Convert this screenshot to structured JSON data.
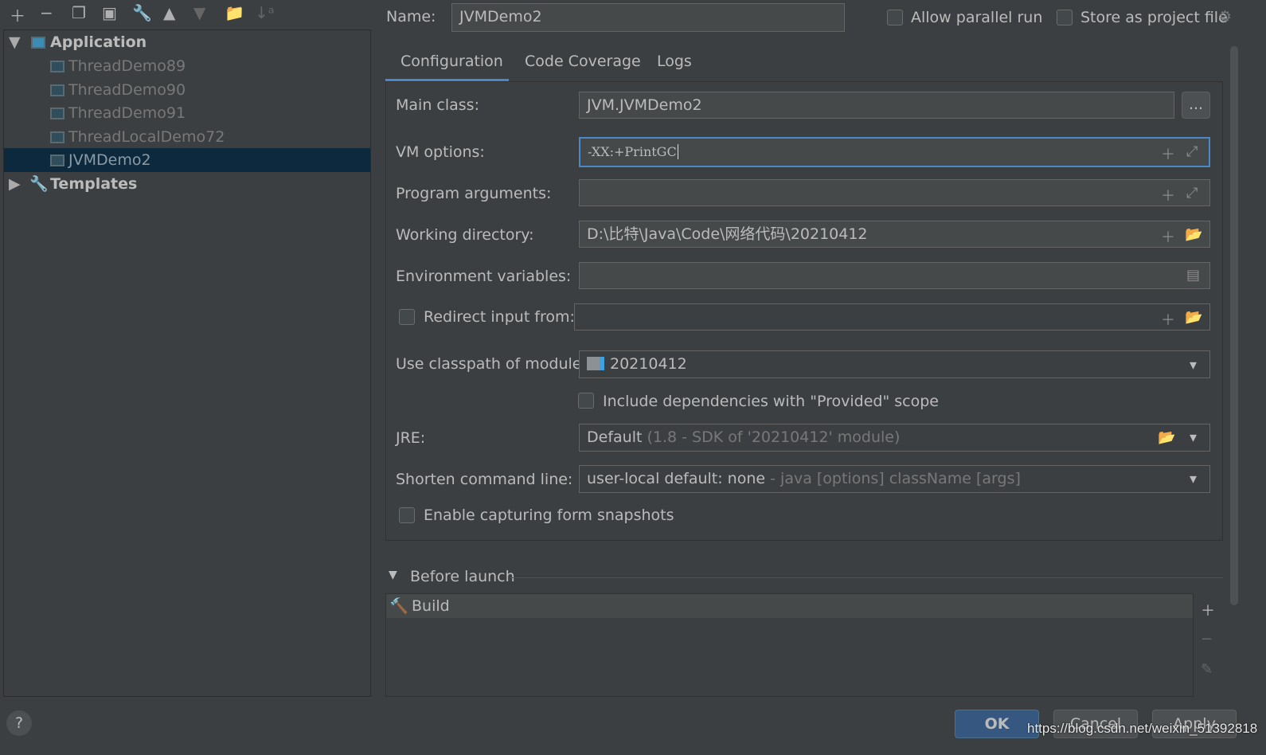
{
  "toolbar": {
    "icons": [
      "plus-icon",
      "minus-icon",
      "copy-icon",
      "save-icon",
      "wrench-icon",
      "arrow-up-icon",
      "arrow-down-icon",
      "new-folder-icon",
      "sort-alpha-icon"
    ]
  },
  "tree": {
    "application": "Application",
    "items": [
      "ThreadDemo89",
      "ThreadDemo90",
      "ThreadDemo91",
      "ThreadLocalDemo72",
      "JVMDemo2"
    ],
    "selected": "JVMDemo2",
    "templates": "Templates"
  },
  "header": {
    "name_label": "Name:",
    "name_value": "JVMDemo2",
    "allow_parallel": "Allow parallel run",
    "store_project": "Store as project file"
  },
  "tabs": [
    "Configuration",
    "Code Coverage",
    "Logs"
  ],
  "form": {
    "main_class_label": "Main class:",
    "main_class": "JVM.JVMDemo2",
    "browse": "...",
    "vm_label": "VM options:",
    "vm_value": "-XX:+PrintGC",
    "args_label": "Program arguments:",
    "args_value": "",
    "wd_label": "Working directory:",
    "wd_value": "D:\\比特\\Java\\Code\\网络代码\\20210412",
    "env_label": "Environment variables:",
    "env_value": "",
    "redirect_label": "Redirect input from:",
    "module_label": "Use classpath of module:",
    "module_value": "20210412",
    "include_deps": "Include dependencies with \"Provided\" scope",
    "jre_label": "JRE:",
    "jre_value": "Default",
    "jre_hint": "(1.8 - SDK of '20210412' module)",
    "shorten_label": "Shorten command line:",
    "shorten_value": "user-local default: none",
    "shorten_hint": "- java [options] className [args]",
    "snapshots": "Enable capturing form snapshots"
  },
  "before_launch": {
    "title": "Before launch",
    "items": [
      "Build"
    ]
  },
  "buttons": {
    "ok": "OK",
    "cancel": "Cancel",
    "apply": "Apply",
    "help": "?"
  },
  "watermark": "https://blog.csdn.net/weixin_51392818",
  "colors": {
    "accent": "#4a88c7",
    "selection": "#0d293e",
    "ok": "#365880"
  }
}
